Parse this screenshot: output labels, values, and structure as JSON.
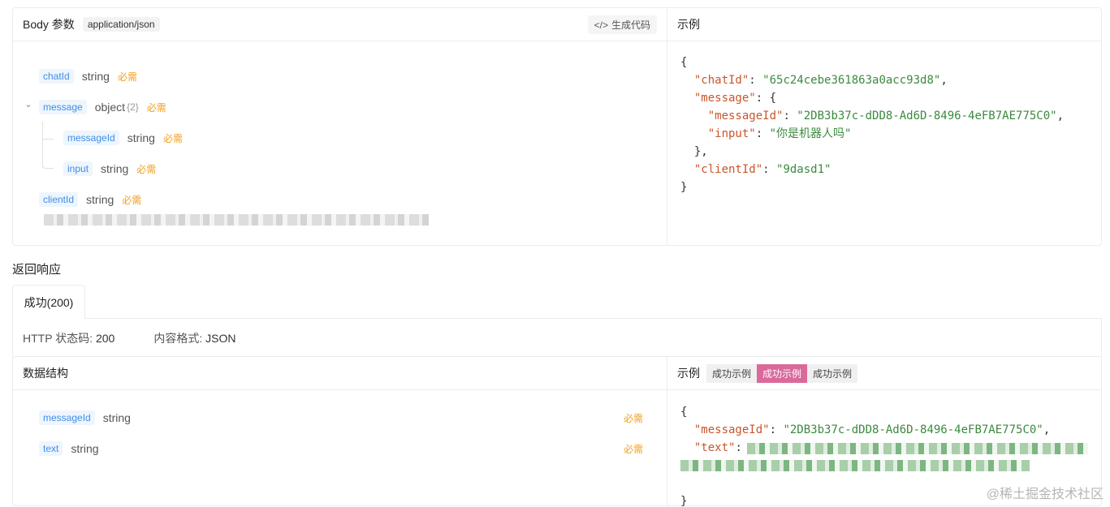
{
  "body_params": {
    "title": "Body 参数",
    "content_type": "application/json",
    "gen_code_label": "生成代码",
    "fields": [
      {
        "name": "chatId",
        "type": "string",
        "required": "必需"
      },
      {
        "name": "message",
        "type": "object",
        "count": "{2}",
        "required": "必需"
      },
      {
        "name": "messageId",
        "type": "string",
        "required": "必需"
      },
      {
        "name": "input",
        "type": "string",
        "required": "必需"
      },
      {
        "name": "clientId",
        "type": "string",
        "required": "必需"
      }
    ]
  },
  "example": {
    "title": "示例",
    "lines": {
      "open": "{",
      "chatId_key": "\"chatId\"",
      "chatId_val": "\"65c24cebe361863a0acc93d8\"",
      "message_key": "\"message\"",
      "messageId_key": "\"messageId\"",
      "messageId_val": "\"2DB3b37c-dDD8-Ad6D-8496-4eFB7AE775C0\"",
      "input_key": "\"input\"",
      "input_val": "\"你是机器人吗\"",
      "clientId_key": "\"clientId\"",
      "clientId_val": "\"9dasd1\"",
      "close": "}"
    }
  },
  "response": {
    "section_title": "返回响应",
    "tab_label": "成功(200)",
    "http_status_label": "HTTP 状态码:",
    "http_status_value": "200",
    "content_format_label": "内容格式:",
    "content_format_value": "JSON",
    "structure_title": "数据结构",
    "fields": [
      {
        "name": "messageId",
        "type": "string",
        "required": "必需"
      },
      {
        "name": "text",
        "type": "string",
        "required": "必需"
      }
    ],
    "example_title": "示例",
    "example_tabs": [
      "成功示例",
      "成功示例",
      "成功示例"
    ],
    "example_lines": {
      "open": "{",
      "messageId_key": "\"messageId\"",
      "messageId_val": "\"2DB3b37c-dDD8-Ad6D-8496-4eFB7AE775C0\"",
      "text_key": "\"text\"",
      "close": "}"
    }
  },
  "watermark": "@稀土掘金技术社区",
  "colors": {
    "field_name": "#3f8ee6",
    "required": "#f0a020",
    "json_key": "#c9552b",
    "json_string": "#3b8a3e",
    "active_tab": "#d96a9a"
  }
}
